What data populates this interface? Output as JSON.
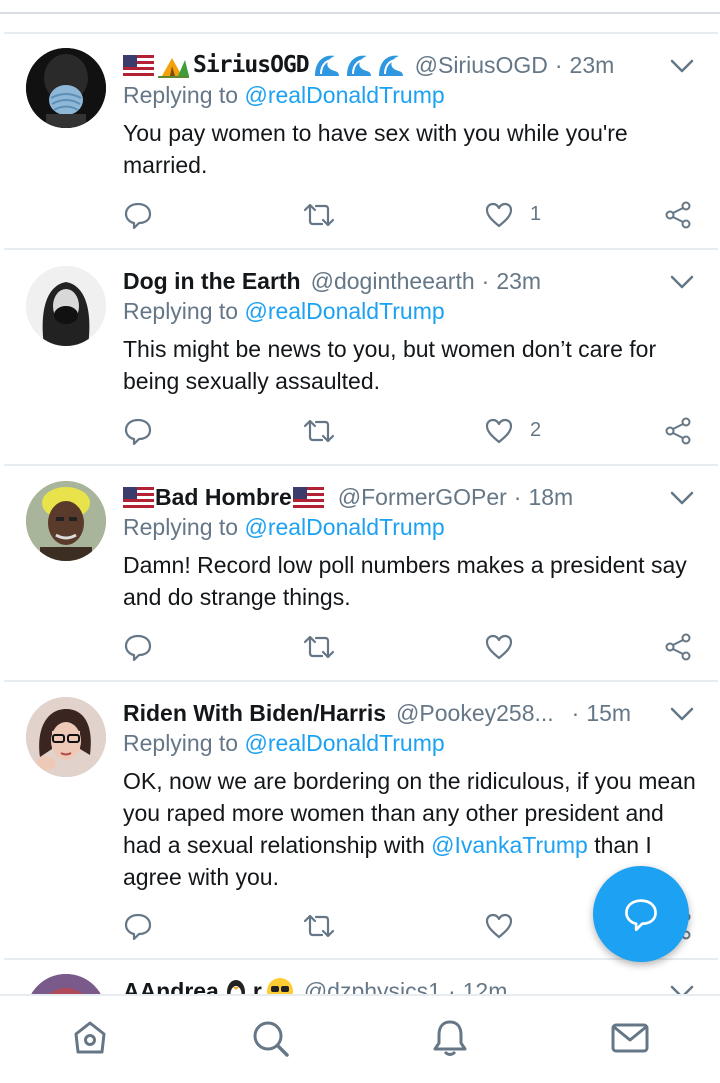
{
  "tweets": [
    {
      "name_left_emoji": "🇺🇸⛺",
      "display_name": "SiriusOGD",
      "name_right_emoji": "🌊🌊🌊",
      "handle": "@SiriusOGD",
      "time": "23m",
      "replying_label": "Replying to",
      "replying_to": "@realDonaldTrump",
      "text": "You pay women to have sex with you while you're married.",
      "likes": "1",
      "avatar": "mask-wearing-person-avatar"
    },
    {
      "display_name": "Dog in the Earth",
      "handle": "@dogintheearth",
      "time": "23m",
      "replying_label": "Replying to",
      "replying_to": "@realDonaldTrump",
      "text": "This might be news to you, but women don’t care for being sexually assaulted.",
      "likes": "2",
      "avatar": "masked-woman-avatar"
    },
    {
      "name_left_emoji": "🇺🇸",
      "display_name": "Bad Hombre",
      "name_right_emoji": "🇺🇸",
      "handle": "@FormerGOPer",
      "time": "18m",
      "replying_label": "Replying to",
      "replying_to": "@realDonaldTrump",
      "text": "Damn! Record low poll numbers makes a president say and do strange things.",
      "likes": "",
      "avatar": "elderly-man-avatar"
    },
    {
      "display_name": "Riden With Biden/Harris",
      "handle": "@Pookey258...",
      "time": "15m",
      "replying_label": "Replying to",
      "replying_to": "@realDonaldTrump",
      "text": "OK, now we are bordering on the ridiculous, if you mean you raped more women than any other president and had a sexual relationship with",
      "text_mention": "@IvankaTrump",
      "text_after": " than I agree with you.",
      "likes": "",
      "avatar": "woman-with-glasses-avatar"
    },
    {
      "display_name": "AAndrea",
      "name_right_emoji": "🐧",
      "name_suffix": "r",
      "name_suffix_emoji": "😎",
      "handle": "@dzphysics1",
      "time": "12m"
    }
  ],
  "colors": {
    "accent": "#1da1f2",
    "secondary_text": "#657786",
    "primary_text": "#14171a",
    "divider": "#e6ecf0"
  },
  "nav": [
    "home-icon",
    "search-icon",
    "notifications-icon",
    "messages-icon"
  ],
  "fab_icon": "compose-reply-icon"
}
